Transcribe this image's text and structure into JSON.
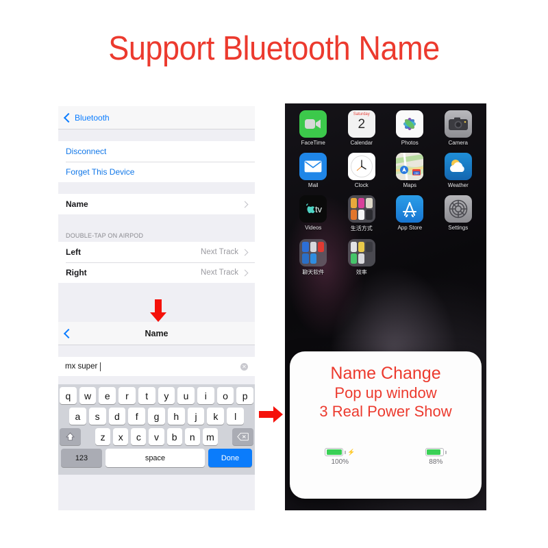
{
  "banner": {
    "title": "Support Bluetooth Name",
    "color": "#EC3A2E"
  },
  "left_phone": {
    "nav": {
      "back_label": "Bluetooth",
      "back_icon": "chevron-left-icon"
    },
    "actions": [
      {
        "label": "Disconnect"
      },
      {
        "label": "Forget This Device"
      }
    ],
    "name_row": {
      "label": "Name",
      "chevron": "chevron-right-icon"
    },
    "section_header": "DOUBLE-TAP ON AIRPOD",
    "tap_rows": [
      {
        "label": "Left",
        "value": "Next Track"
      },
      {
        "label": "Right",
        "value": "Next Track"
      }
    ]
  },
  "name_screen": {
    "nav": {
      "back_icon": "chevron-left-icon",
      "title": "Name"
    },
    "field": {
      "value": "mx super",
      "clear_icon": "clear-circle-icon"
    },
    "keyboard": {
      "row1": [
        "q",
        "w",
        "e",
        "r",
        "t",
        "y",
        "u",
        "i",
        "o",
        "p"
      ],
      "row2": [
        "a",
        "s",
        "d",
        "f",
        "g",
        "h",
        "j",
        "k",
        "l"
      ],
      "row3": [
        "z",
        "x",
        "c",
        "v",
        "b",
        "n",
        "m"
      ],
      "shift_icon": "shift-arrow-icon",
      "backspace_icon": "backspace-icon",
      "numeric_key": "123",
      "space_key": "space",
      "done_key": "Done",
      "done_color": "#0B7CFB"
    }
  },
  "right_phone": {
    "apps": [
      {
        "name": "FaceTime",
        "icon": "facetime-icon"
      },
      {
        "name": "Calendar",
        "icon": "calendar-icon",
        "weekday": "Saturday",
        "day": "2"
      },
      {
        "name": "Photos",
        "icon": "photos-icon"
      },
      {
        "name": "Camera",
        "icon": "camera-icon"
      },
      {
        "name": "Mail",
        "icon": "mail-icon"
      },
      {
        "name": "Clock",
        "icon": "clock-icon"
      },
      {
        "name": "Maps",
        "icon": "maps-icon"
      },
      {
        "name": "Weather",
        "icon": "weather-icon"
      },
      {
        "name": "Videos",
        "icon": "apple-tv-icon"
      },
      {
        "name": "生活方式",
        "icon": "folder-icon"
      },
      {
        "name": "App Store",
        "icon": "app-store-icon"
      },
      {
        "name": "Settings",
        "icon": "settings-gear-icon"
      },
      {
        "name": "聊天软件",
        "icon": "folder-icon"
      },
      {
        "name": "效率",
        "icon": "folder-icon"
      }
    ],
    "popup": {
      "line1": "Name Change",
      "line2": "Pop up window",
      "line3": "3 Real Power Show",
      "text_color": "#EC3A2E",
      "batteries": [
        {
          "percent_label": "100%",
          "level": 100,
          "charging": true,
          "bolt_icon": "lightning-bolt-icon",
          "color": "#3AD056"
        },
        {
          "percent_label": "88%",
          "level": 88,
          "charging": false,
          "color": "#3AD056"
        }
      ]
    }
  },
  "arrows": [
    {
      "name": "arrow-down",
      "direction": "down",
      "color": "#F5110A"
    },
    {
      "name": "arrow-right",
      "direction": "right",
      "color": "#F5110A"
    }
  ]
}
